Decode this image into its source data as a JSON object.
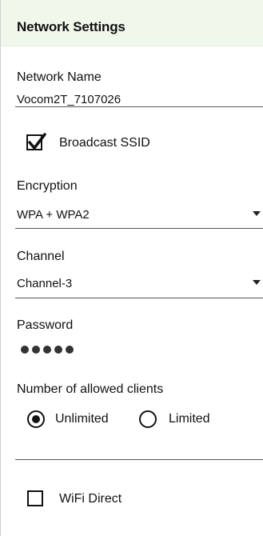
{
  "header": {
    "title": "Network Settings"
  },
  "network_name": {
    "label": "Network Name",
    "value": "Vocom2T_7107026"
  },
  "broadcast_ssid": {
    "label": "Broadcast SSID",
    "checked": true
  },
  "encryption": {
    "label": "Encryption",
    "value": "WPA + WPA2"
  },
  "channel": {
    "label": "Channel",
    "value": "Channel-3"
  },
  "password": {
    "label": "Password",
    "masked_length": 5
  },
  "clients": {
    "label": "Number of allowed clients",
    "options": [
      {
        "label": "Unlimited",
        "selected": true
      },
      {
        "label": "Limited",
        "selected": false
      }
    ]
  },
  "wifi_direct": {
    "label": "WiFi Direct",
    "checked": false
  }
}
